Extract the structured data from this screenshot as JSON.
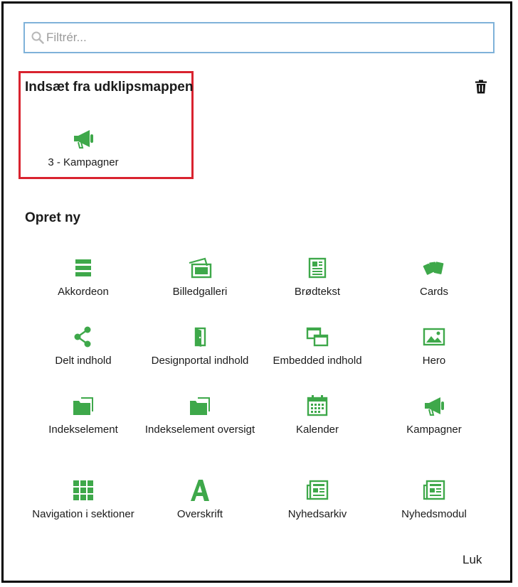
{
  "search": {
    "placeholder": "Filtrér..."
  },
  "clipboard": {
    "title": "Indsæt fra udklipsmappen",
    "items": [
      {
        "label": "3 - Kampagner",
        "icon": "megaphone-icon"
      }
    ]
  },
  "create": {
    "title": "Opret ny",
    "items": [
      {
        "label": "Akkordeon",
        "icon": "accordion-icon"
      },
      {
        "label": "Billedgalleri",
        "icon": "gallery-icon"
      },
      {
        "label": "Brødtekst",
        "icon": "text-document-icon"
      },
      {
        "label": "Cards",
        "icon": "cards-icon"
      },
      {
        "label": "Delt indhold",
        "icon": "share-icon"
      },
      {
        "label": "Designportal indhold",
        "icon": "door-icon"
      },
      {
        "label": "Embedded indhold",
        "icon": "windows-icon"
      },
      {
        "label": "Hero",
        "icon": "picture-icon"
      },
      {
        "label": "Indekselement",
        "icon": "folder-icon"
      },
      {
        "label": "Indekselement oversigt",
        "icon": "folder-icon"
      },
      {
        "label": "Kalender",
        "icon": "calendar-icon"
      },
      {
        "label": "Kampagner",
        "icon": "megaphone-icon"
      },
      {
        "label": "Navigation i sektioner",
        "icon": "grid-icon"
      },
      {
        "label": "Overskrift",
        "icon": "letter-a-icon"
      },
      {
        "label": "Nyhedsarkiv",
        "icon": "newspaper-icon"
      },
      {
        "label": "Nyhedsmodul",
        "icon": "newspaper-icon"
      }
    ]
  },
  "footer": {
    "close_label": "Luk"
  },
  "colors": {
    "accent": "#3ea84a",
    "highlight": "#d9232f",
    "search_border": "#7fb2d9"
  }
}
